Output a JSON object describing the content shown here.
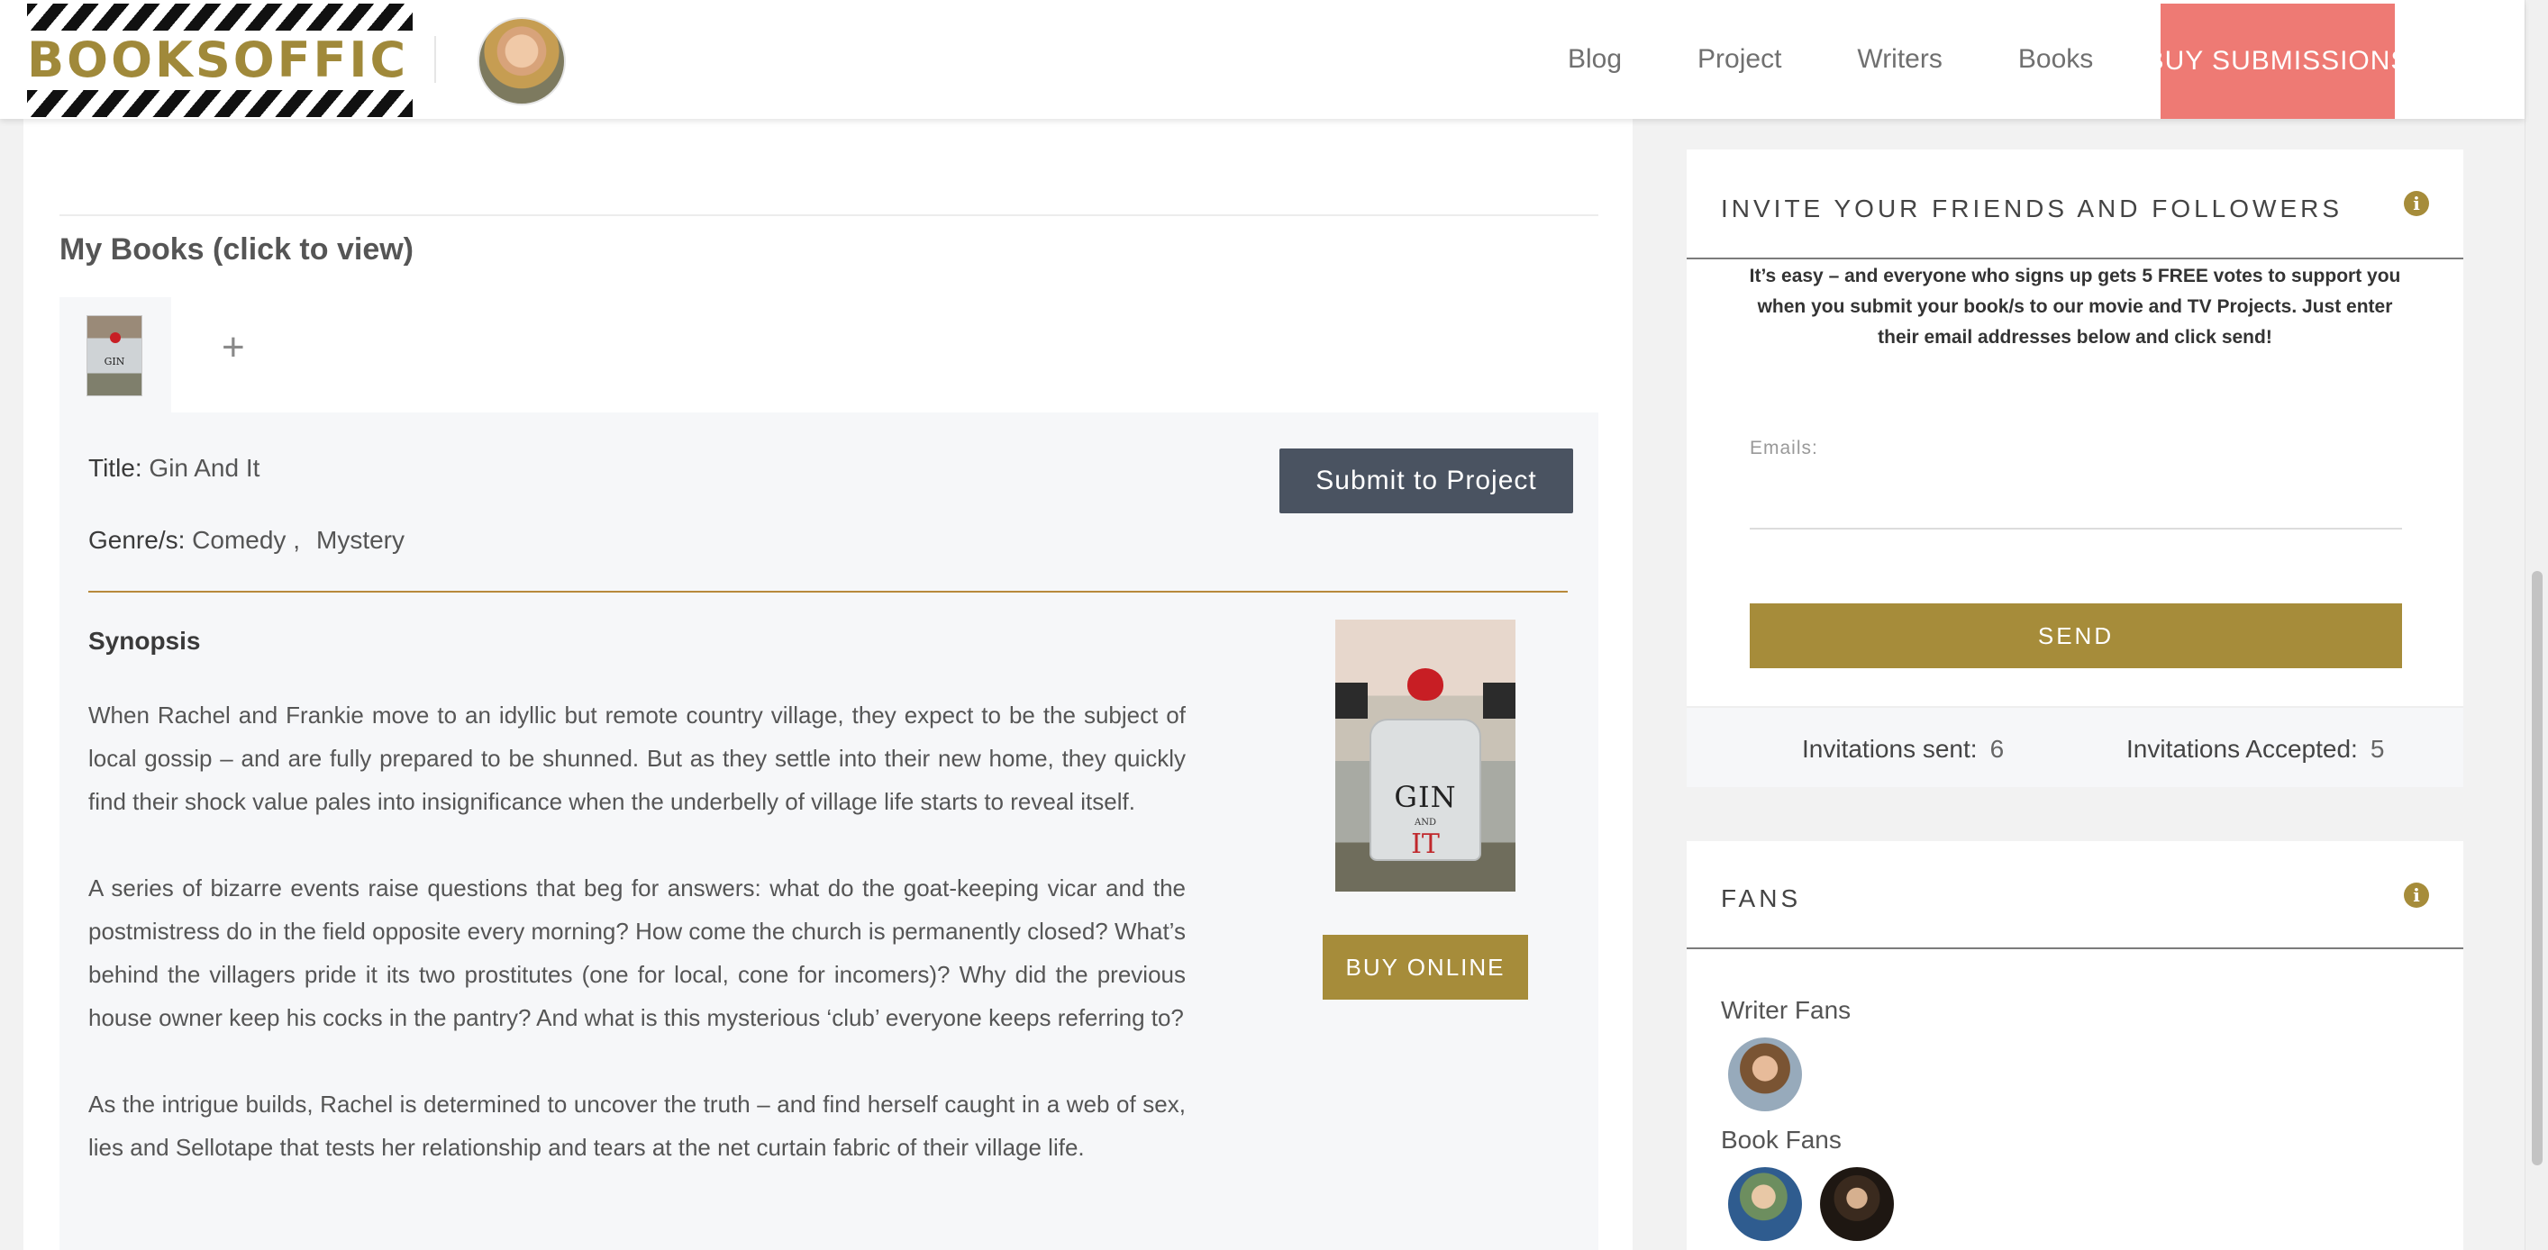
{
  "header": {
    "logo_text": "BOOKSOFFICE",
    "nav": [
      "Blog",
      "Project",
      "Writers",
      "Books"
    ],
    "cta_label": "BUY SUBMISSIONS"
  },
  "books": {
    "heading": "My Books (click to view)",
    "add_symbol": "+",
    "thumb_title": "GIN",
    "title_key": "Title:",
    "title_value": "Gin And It",
    "genre_key": "Genre/s:",
    "genres": [
      "Comedy ,",
      "Mystery"
    ],
    "submit_label": "Submit to Project",
    "synopsis_heading": "Synopsis",
    "synopsis": [
      "When Rachel and Frankie move to an idyllic but remote country village, they expect to be the subject of local gossip – and are fully prepared to be shunned. But as they settle into their new home, they quickly find their shock value pales into insignificance when the underbelly of village life starts to reveal itself.",
      "A series of bizarre events raise questions that beg for answers: what do the goat-keeping vicar and the postmistress do in the field opposite every morning? How come the church is permanently closed? What’s behind the villagers pride it its two prostitutes (one for local, cone for incomers)? Why did the previous house owner keep his cocks in the pantry? And what is this mysterious ‘club’ everyone keeps referring to?",
      "As the intrigue builds, Rachel is determined to uncover the truth – and find herself caught in a web of sex, lies and Sellotape that tests her relationship and tears at the net curtain fabric of their village life."
    ],
    "cover": {
      "line1": "GIN",
      "line2": "AND",
      "line3": "IT"
    },
    "buy_online_label": "BUY ONLINE"
  },
  "invite": {
    "title": "INVITE YOUR FRIENDS AND FOLLOWERS",
    "info_glyph": "i",
    "description": "It’s easy – and everyone who signs up gets 5 FREE votes to support you when you submit your book/s to our movie and TV Projects. Just enter their email addresses below and click send!",
    "emails_label": "Emails:",
    "emails_value": "",
    "send_label": "SEND",
    "sent_label": "Invitations sent:",
    "sent_value": "6",
    "accepted_label": "Invitations Accepted:",
    "accepted_value": "5"
  },
  "fans": {
    "title": "FANS",
    "info_glyph": "i",
    "writer_fans_label": "Writer Fans",
    "book_fans_label": "Book Fans"
  },
  "colors": {
    "gold": "#a68c3a",
    "cta_coral": "#ee7a74",
    "slate_button": "#4a5361"
  }
}
